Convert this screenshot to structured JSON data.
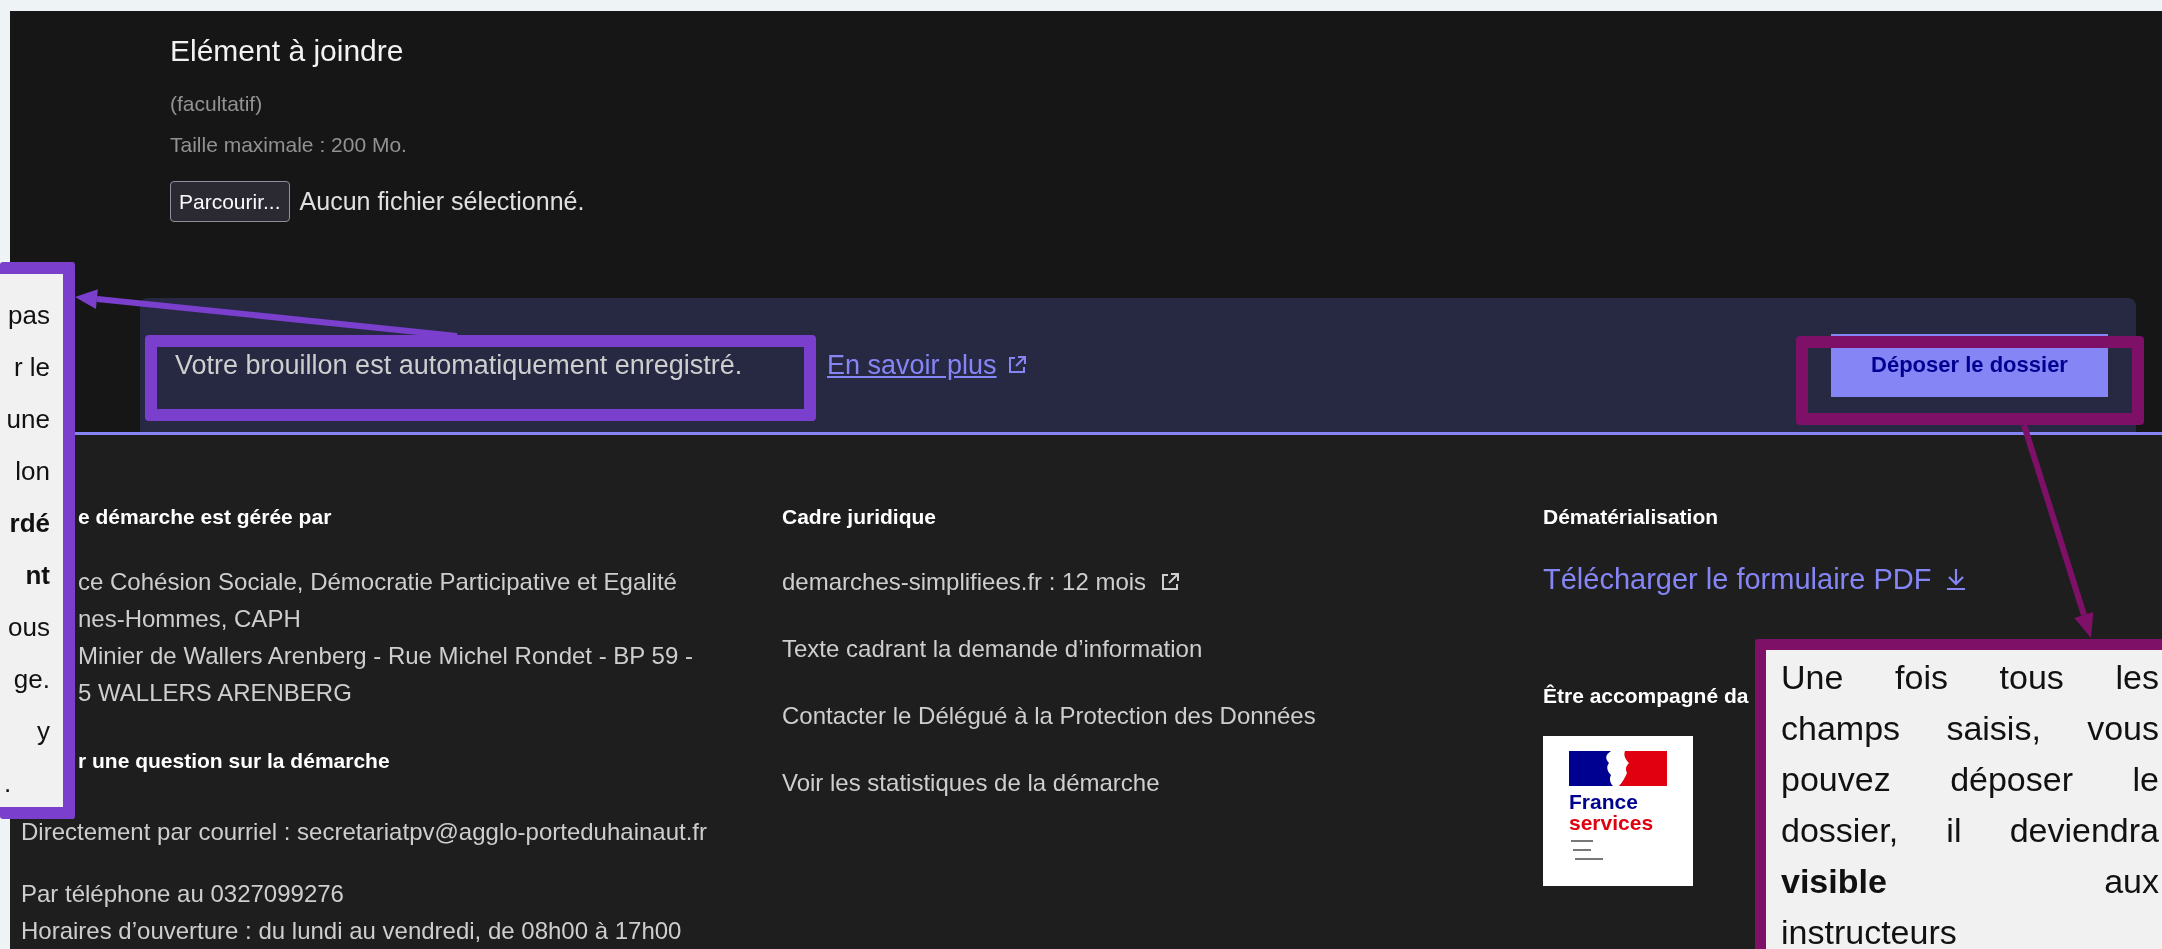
{
  "attachment": {
    "title": "Elément à joindre",
    "optional_hint": "(facultatif)",
    "size_hint": "Taille maximale : 200 Mo.",
    "browse_button": "Parcourir...",
    "file_status": "Aucun fichier sélectionné."
  },
  "draft_banner": {
    "message": "Votre brouillon est automatiquement enregistré.",
    "link": "En savoir plus",
    "submit_button": "Déposer le dossier"
  },
  "footer": {
    "managed_by": {
      "heading": "e démarche est gérée par",
      "address_lines": [
        "ce Cohésion Sociale, Démocratie Participative et Egalité",
        "nes-Hommes, CAPH",
        "Minier de Wallers Arenberg - Rue Michel Rondet - BP 59 -",
        "5 WALLERS ARENBERG"
      ],
      "question_heading": "r une question sur la démarche",
      "email": "Directement par courriel : secretariatpv@agglo-porteduhainaut.fr",
      "phone": "Par téléphone au 0327099276",
      "hours": "Horaires d’ouverture : du lundi au vendredi, de 08h00 à 17h00"
    },
    "legal": {
      "heading": "Cadre juridique",
      "links": [
        {
          "label": "demarches-simplifiees.fr : 12 mois",
          "external": true
        },
        {
          "label": "Texte cadrant la demande d’information",
          "external": false
        },
        {
          "label": "Contacter le Délégué à la Protection des Données",
          "external": false
        },
        {
          "label": "Voir les statistiques de la démarche",
          "external": false
        }
      ]
    },
    "digital": {
      "heading": "Dématérialisation",
      "download_link": "Télécharger le formulaire PDF",
      "support_heading": "Être accompagné da",
      "logo": {
        "line1": "France",
        "line2": "services"
      }
    }
  },
  "annotations": [
    {
      "kind": "left",
      "lines": [
        "pas",
        "r le",
        "une",
        "lon",
        "**rdé**",
        "**nt**",
        "ous",
        "ge.",
        "y",
        "."
      ]
    },
    {
      "kind": "right",
      "lines": [
        "Une fois tous les",
        "champs saisis, vous",
        "pouvez déposer le",
        "dossier, il deviendra",
        "**visible** aux",
        "instructeurs"
      ]
    }
  ]
}
